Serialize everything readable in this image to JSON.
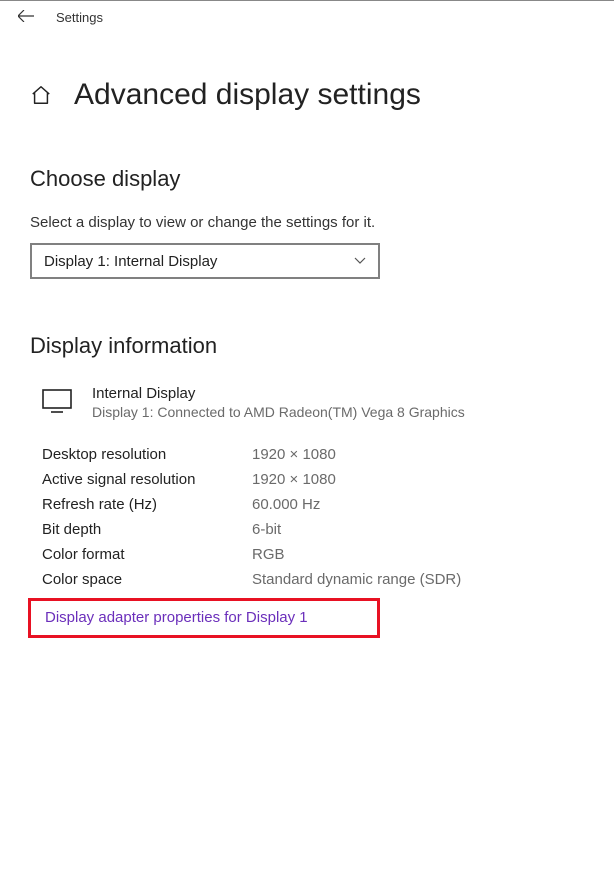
{
  "titlebar": {
    "label": "Settings"
  },
  "page_title": "Advanced display settings",
  "choose_display": {
    "heading": "Choose display",
    "description": "Select a display to view or change the settings for it.",
    "selected": "Display 1: Internal Display"
  },
  "display_information": {
    "heading": "Display information",
    "name": "Internal Display",
    "subtext": "Display 1: Connected to AMD Radeon(TM) Vega 8 Graphics",
    "rows": [
      {
        "label": "Desktop resolution",
        "value": "1920 × 1080"
      },
      {
        "label": "Active signal resolution",
        "value": "1920 × 1080"
      },
      {
        "label": "Refresh rate (Hz)",
        "value": "60.000 Hz"
      },
      {
        "label": "Bit depth",
        "value": "6-bit"
      },
      {
        "label": "Color format",
        "value": "RGB"
      },
      {
        "label": "Color space",
        "value": "Standard dynamic range (SDR)"
      }
    ],
    "link_label": "Display adapter properties for Display 1"
  },
  "highlight_color": "#e81123"
}
